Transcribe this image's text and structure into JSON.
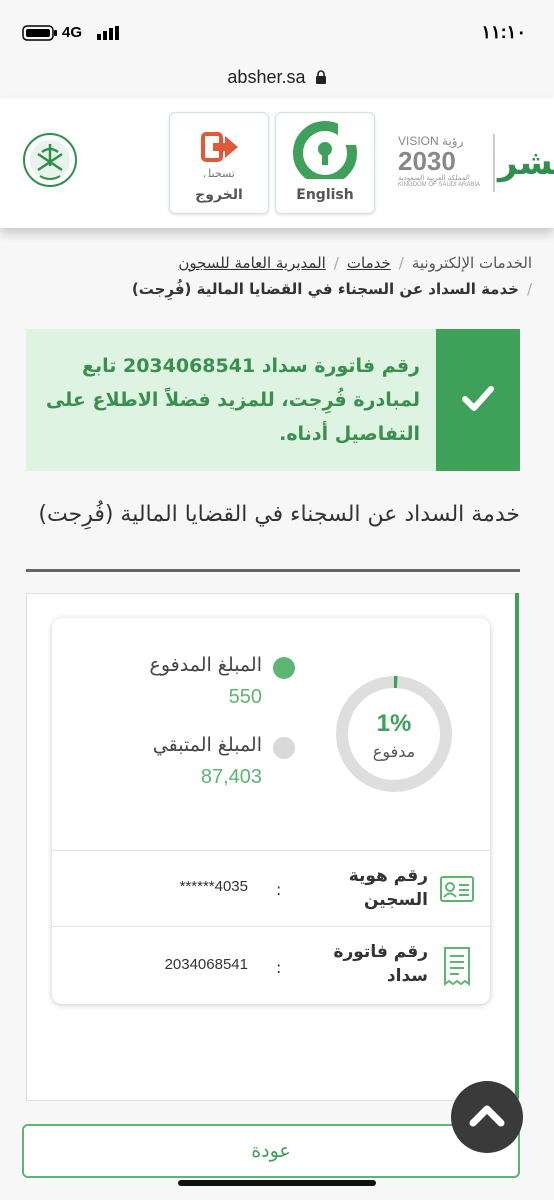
{
  "status_bar": {
    "time": "١١:١٠",
    "network": "4G"
  },
  "url_bar": {
    "url": "absher.sa"
  },
  "header": {
    "english_label": "English",
    "logout_label": "الخروج",
    "logout_sublabel": "تسجيل",
    "vision_brand": "أبشر",
    "vision_title": "VISION رؤية",
    "vision_year": "2030",
    "vision_sub_ar": "المملكة العربية السعودية",
    "vision_sub_en": "KINGDOM OF SAUDI ARABIA"
  },
  "breadcrumb": {
    "items": [
      "الخدمات الإلكترونية",
      "خدمات",
      "المديرية العامة للسجون"
    ],
    "current": "خدمة السداد عن السجناء في القضايا المالية (فُرِجت)"
  },
  "alert": {
    "message": "رقم فاتورة سداد 2034068541 تابع لمبادرة فُرِجت، للمزيد فضلاً الاطلاع على التفاصيل أدناه."
  },
  "section": {
    "title": "خدمة السداد عن السجناء في القضايا المالية (فُرِجت)"
  },
  "summary": {
    "paid_label": "المبلغ المدفوع",
    "paid_value": "550",
    "remaining_label": "المبلغ المتبقي",
    "remaining_value": "87,403",
    "percent_text": "1%",
    "percent_fraction": 0.01,
    "percent_sub": "مدفوع"
  },
  "details": {
    "prisoner_id_label": "رقم هوية السجين",
    "prisoner_id_value": "******4035",
    "invoice_label": "رقم فاتورة سداد",
    "invoice_value": "2034068541",
    "colon": ":"
  },
  "actions": {
    "back_label": "عودة"
  },
  "colors": {
    "primary_green": "#3fa05a",
    "light_green": "#dff3e3",
    "paid_dot": "#5cb573",
    "remaining_dot": "#d9d9d9"
  }
}
